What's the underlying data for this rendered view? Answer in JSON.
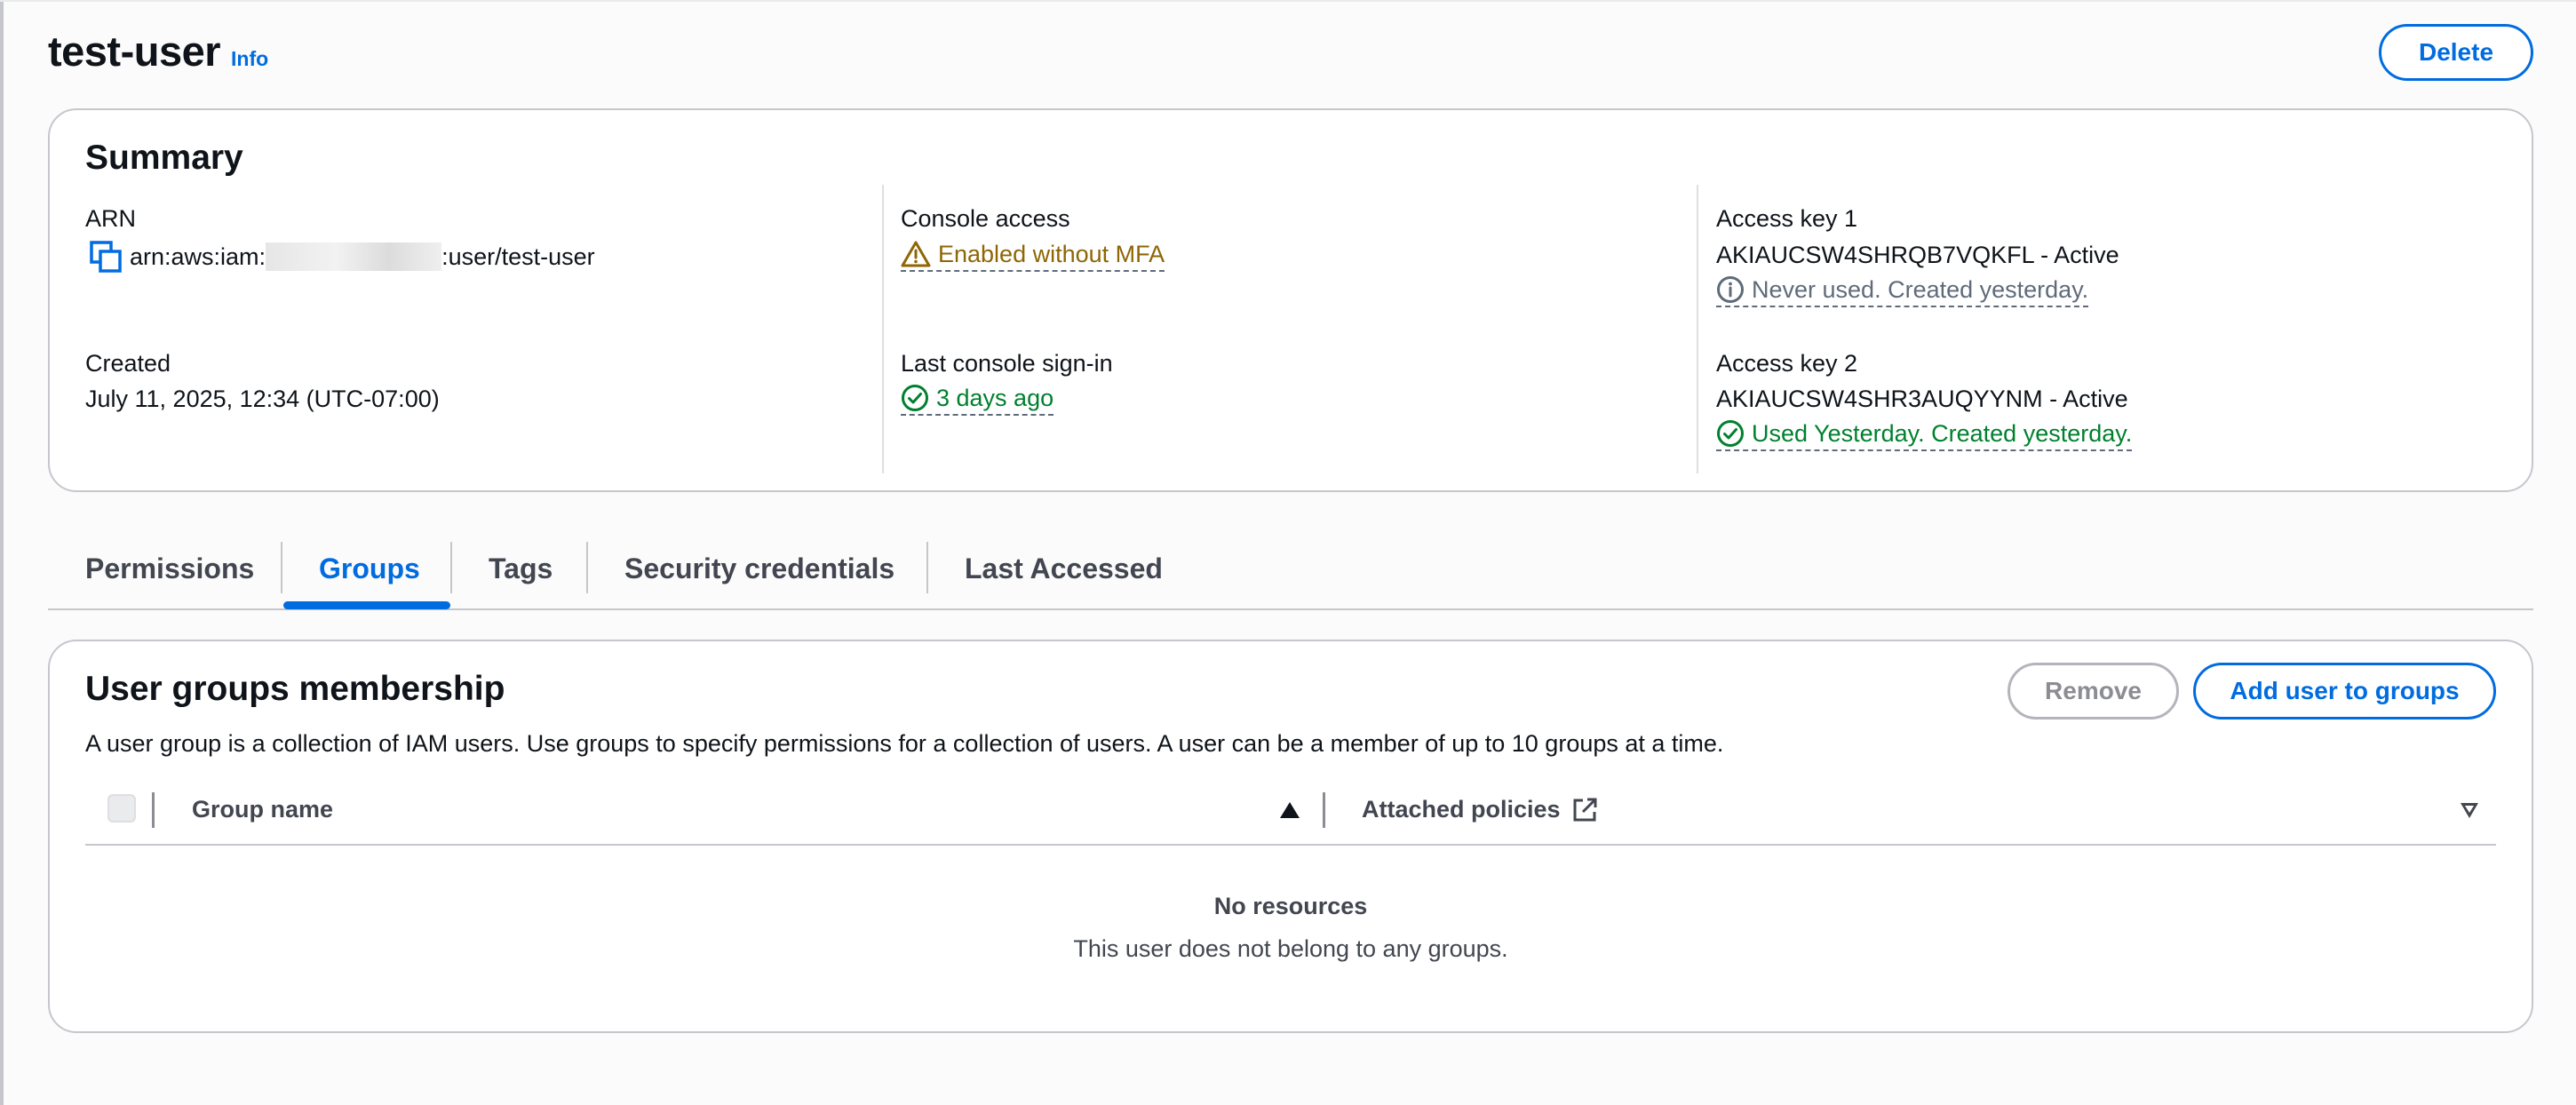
{
  "header": {
    "title": "test-user",
    "info_label": "Info",
    "delete_label": "Delete"
  },
  "summary": {
    "title": "Summary",
    "arn": {
      "label": "ARN",
      "prefix": "arn:aws:iam:",
      "suffix": ":user/test-user"
    },
    "created": {
      "label": "Created",
      "value": "July 11, 2025, 12:34 (UTC-07:00)"
    },
    "console_access": {
      "label": "Console access",
      "value": "Enabled without MFA",
      "icon": "warning-icon"
    },
    "last_signin": {
      "label": "Last console sign-in",
      "value": "3 days ago",
      "icon": "check-circle-icon"
    },
    "access_key_1": {
      "label": "Access key 1",
      "value": "AKIAUCSW4SHRQB7VQKFL - Active",
      "status": "Never used. Created yesterday.",
      "icon": "info-icon"
    },
    "access_key_2": {
      "label": "Access key 2",
      "value": "AKIAUCSW4SHR3AUQYYNM - Active",
      "status": "Used Yesterday. Created yesterday.",
      "icon": "check-circle-icon"
    }
  },
  "tabs": [
    {
      "label": "Permissions",
      "active": false
    },
    {
      "label": "Groups",
      "active": true
    },
    {
      "label": "Tags",
      "active": false
    },
    {
      "label": "Security credentials",
      "active": false
    },
    {
      "label": "Last Accessed",
      "active": false
    }
  ],
  "groups": {
    "title": "User groups membership",
    "description": "A user group is a collection of IAM users. Use groups to specify permissions for a collection of users. A user can be a member of up to 10 groups at a time.",
    "remove_label": "Remove",
    "add_label": "Add user to groups",
    "columns": [
      "Group name",
      "Attached policies"
    ],
    "empty_title": "No resources",
    "empty_subtitle": "This user does not belong to any groups."
  },
  "colors": {
    "accent": "#006ce0",
    "warning": "#8d6605",
    "success": "#00802f",
    "muted": "#5f6b7a"
  }
}
